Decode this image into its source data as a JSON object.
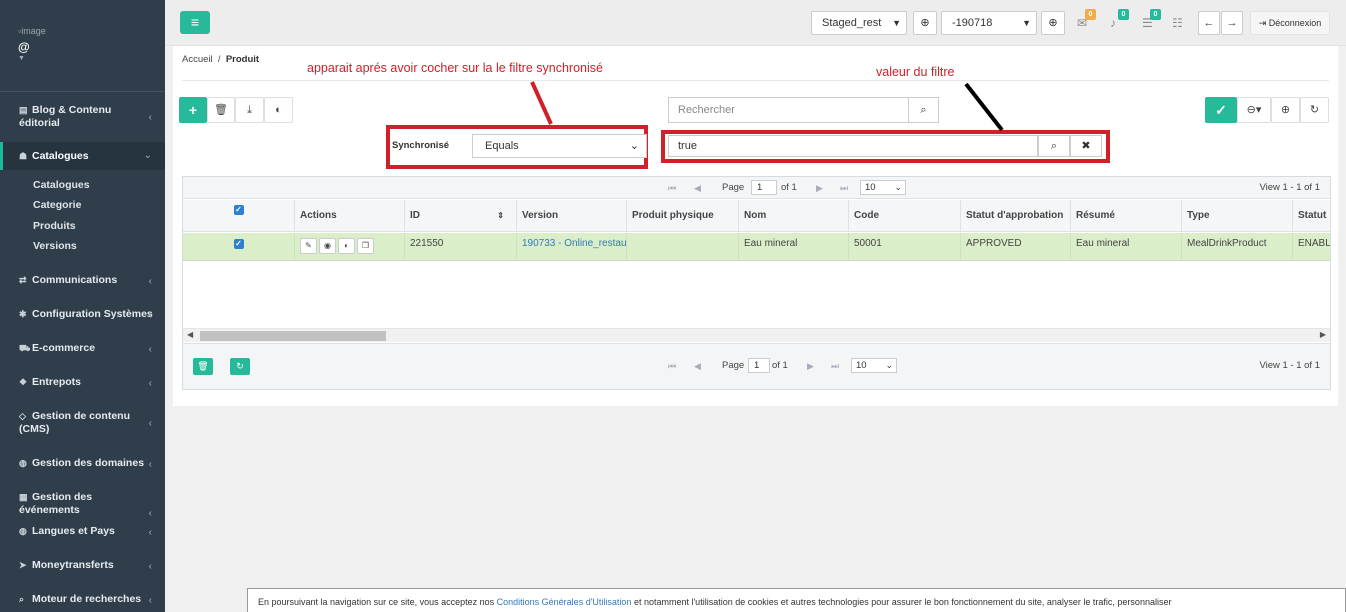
{
  "sidebar": {
    "brand_alt": "image",
    "brand_at": "@",
    "items": [
      {
        "label": "Blog & Contenu éditorial",
        "icon": "document-icon"
      },
      {
        "label": "Catalogues",
        "icon": "sitemap-icon"
      },
      {
        "label": "Communications",
        "icon": "exchange-icon"
      },
      {
        "label": "Configuration Systèmes",
        "icon": "gear-icon"
      },
      {
        "label": "E-commerce",
        "icon": "cart-icon"
      },
      {
        "label": "Entrepots",
        "icon": "cubes-icon"
      },
      {
        "label": "Gestion de contenu (CMS)",
        "icon": "diamond-icon"
      },
      {
        "label": "Gestion des domaines",
        "icon": "globe-icon"
      },
      {
        "label": "Gestion des événements",
        "icon": "calendar-icon"
      },
      {
        "label": "Langues et Pays",
        "icon": "globe-icon"
      },
      {
        "label": "Moneytransferts",
        "icon": "send-icon"
      },
      {
        "label": "Moteur de recherches",
        "icon": "search-icon"
      }
    ],
    "sub_items": [
      "Catalogues",
      "Categorie",
      "Produits",
      "Versions"
    ]
  },
  "topbar": {
    "catalog_select": "Staged_rest",
    "version_select": "-190718",
    "badge_mail": "0",
    "badge_bell": "0",
    "badge_tasks": "0",
    "logout_label": "Déconnexion"
  },
  "breadcrumb": {
    "home": "Accueil",
    "separator": "/",
    "current": "Produit"
  },
  "search": {
    "placeholder": "Rechercher"
  },
  "filter": {
    "label": "Synchronisé",
    "operator": "Equals",
    "value": "true"
  },
  "pager": {
    "page_label": "Page",
    "page": "1",
    "of_label": "of 1",
    "page_size": "10",
    "view_text": "View 1 - 1 of 1"
  },
  "table": {
    "columns": [
      "",
      "Actions",
      "ID",
      "Version",
      "Produit physique",
      "Nom",
      "Code",
      "Statut d'approbation",
      "Résumé",
      "Type",
      "Statut"
    ],
    "rows": [
      {
        "id": "221550",
        "version": "190733 - Online_restaur",
        "physique": "",
        "nom": "Eau mineral",
        "code": "50001",
        "statut_approbation": "APPROVED",
        "resume": "Eau mineral",
        "type": "MealDrinkProduct",
        "statut": "ENABL"
      }
    ]
  },
  "annotations": {
    "filter_note": "apparait aprés avoir cocher sur la le filtre synchronisé",
    "value_note": "valeur du filtre"
  },
  "cookie": {
    "prefix": "En poursuivant la navigation sur ce site, vous acceptez nos ",
    "link": "Conditions Générales d'Utilisation",
    "suffix": " et notamment l'utilisation de cookies et autres technologies pour assurer le bon fonctionnement du site, analyser le trafic, personnaliser"
  },
  "colors": {
    "accent": "#26b99a",
    "sidebar": "#2f3e4a",
    "annotation_red": "#d0202a",
    "row_selected": "#dbeeca"
  }
}
